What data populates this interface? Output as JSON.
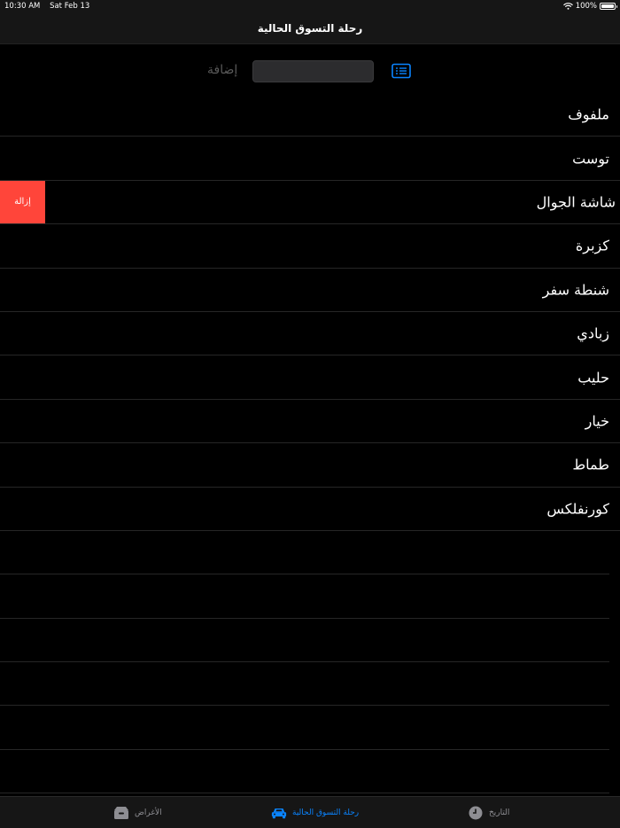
{
  "status_bar": {
    "time": "10:30 AM",
    "date": "Sat Feb 13",
    "battery": "100%",
    "battery_level": 1.0
  },
  "nav": {
    "title": "رحلة التسوق الحالية"
  },
  "add": {
    "label": "إضافة",
    "placeholder": ""
  },
  "items": [
    {
      "label": "ملفوف"
    },
    {
      "label": "توست"
    },
    {
      "label": "شاشة الجوال",
      "delete_label": "إزالة"
    },
    {
      "label": "كزبرة"
    },
    {
      "label": "شنطة سفر"
    },
    {
      "label": "زبادي"
    },
    {
      "label": "حليب"
    },
    {
      "label": "خيار"
    },
    {
      "label": "طماط"
    },
    {
      "label": "كورنفلكس"
    }
  ],
  "tabs": [
    {
      "label": "الأغراض",
      "icon": "box-icon",
      "active": false
    },
    {
      "label": "رحلة التسوق الحالية",
      "icon": "car-icon",
      "active": true
    },
    {
      "label": "التاريخ",
      "icon": "clock-icon",
      "active": false
    }
  ],
  "colors": {
    "accent": "#0a84ff",
    "destructive": "#ff453a",
    "background": "#000000",
    "bar": "#161616"
  }
}
